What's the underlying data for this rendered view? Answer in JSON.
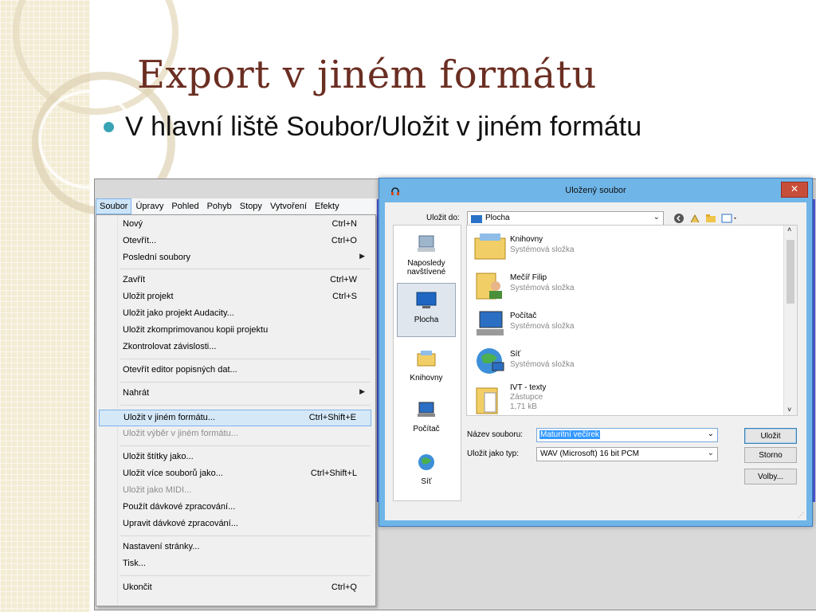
{
  "slide": {
    "title": "Export v jiném formátu",
    "bullet": "V hlavní liště Soubor/Uložit v jiném formátu"
  },
  "colors": {
    "title": "#6b2e22",
    "bullet": "#39a3b5",
    "menu_highlight": "#d5e8f8",
    "dialog_frame": "#6fb5e8",
    "close_button": "#c74f3a",
    "waveform": "#3a47d8"
  },
  "menubar": {
    "items": [
      "Soubor",
      "Úpravy",
      "Pohled",
      "Pohyb",
      "Stopy",
      "Vytvoření",
      "Efekty"
    ],
    "active": "Soubor"
  },
  "file_menu": {
    "items": [
      {
        "label": "Nový",
        "shortcut": "Ctrl+N"
      },
      {
        "label": "Otevřít...",
        "shortcut": "Ctrl+O"
      },
      {
        "label": "Poslední soubory",
        "shortcut": "",
        "arrow": "▶"
      },
      {
        "label": "Zavřít",
        "shortcut": "Ctrl+W"
      },
      {
        "label": "Uložit projekt",
        "shortcut": "Ctrl+S"
      },
      {
        "label": "Uložit jako projekt Audacity...",
        "shortcut": ""
      },
      {
        "label": "Uložit zkomprimovanou kopii projektu",
        "shortcut": ""
      },
      {
        "label": "Zkontrolovat závislosti...",
        "shortcut": ""
      },
      {
        "label": "Otevřít editor popisných dat...",
        "shortcut": ""
      },
      {
        "label": "Nahrát",
        "shortcut": "",
        "arrow": "▶"
      },
      {
        "label": "Uložit v jiném formátu...",
        "shortcut": "Ctrl+Shift+E"
      },
      {
        "label": "Uložit výběr v jiném formátu...",
        "shortcut": ""
      },
      {
        "label": "Uložit štítky jako...",
        "shortcut": ""
      },
      {
        "label": "Uložit více souborů jako...",
        "shortcut": "Ctrl+Shift+L"
      },
      {
        "label": "Uložit jako MIDI...",
        "shortcut": ""
      },
      {
        "label": "Použít dávkové zpracování...",
        "shortcut": ""
      },
      {
        "label": "Upravit dávkové zpracování...",
        "shortcut": ""
      },
      {
        "label": "Nastavení stránky...",
        "shortcut": ""
      },
      {
        "label": "Tisk...",
        "shortcut": ""
      },
      {
        "label": "Ukončit",
        "shortcut": "Ctrl+Q"
      }
    ],
    "highlighted": "Uložit v jiném formátu...",
    "disabled": [
      "Uložit výběr v jiném formátu...",
      "Uložit jako MIDI..."
    ]
  },
  "dialog": {
    "title": "Uložený soubor",
    "close": "✕",
    "save_in_label": "Uložit do:",
    "save_in_value": "Plocha",
    "places": [
      "Naposledy navštívené",
      "Plocha",
      "Knihovny",
      "Počítač",
      "Síť"
    ],
    "selected_place": "Plocha",
    "files": [
      {
        "name": "Knihovny",
        "type": "Systémová složka",
        "icon": "libraries-icon"
      },
      {
        "name": "Mečíř Filip",
        "type": "Systémová složka",
        "icon": "user-folder-icon"
      },
      {
        "name": "Počítač",
        "type": "Systémová složka",
        "icon": "computer-icon"
      },
      {
        "name": "Síť",
        "type": "Systémová složka",
        "icon": "network-icon"
      },
      {
        "name": "IVT - texty",
        "type": "Zástupce",
        "size": "1,71 kB",
        "icon": "shortcut-folder-icon"
      }
    ],
    "filename_label": "Název souboru:",
    "filename_value": "Maturitní večírek",
    "filetype_label": "Uložit jako typ:",
    "filetype_value": "WAV (Microsoft) 16 bit PCM",
    "buttons": {
      "save": "Uložit",
      "cancel": "Storno",
      "options": "Volby..."
    }
  }
}
